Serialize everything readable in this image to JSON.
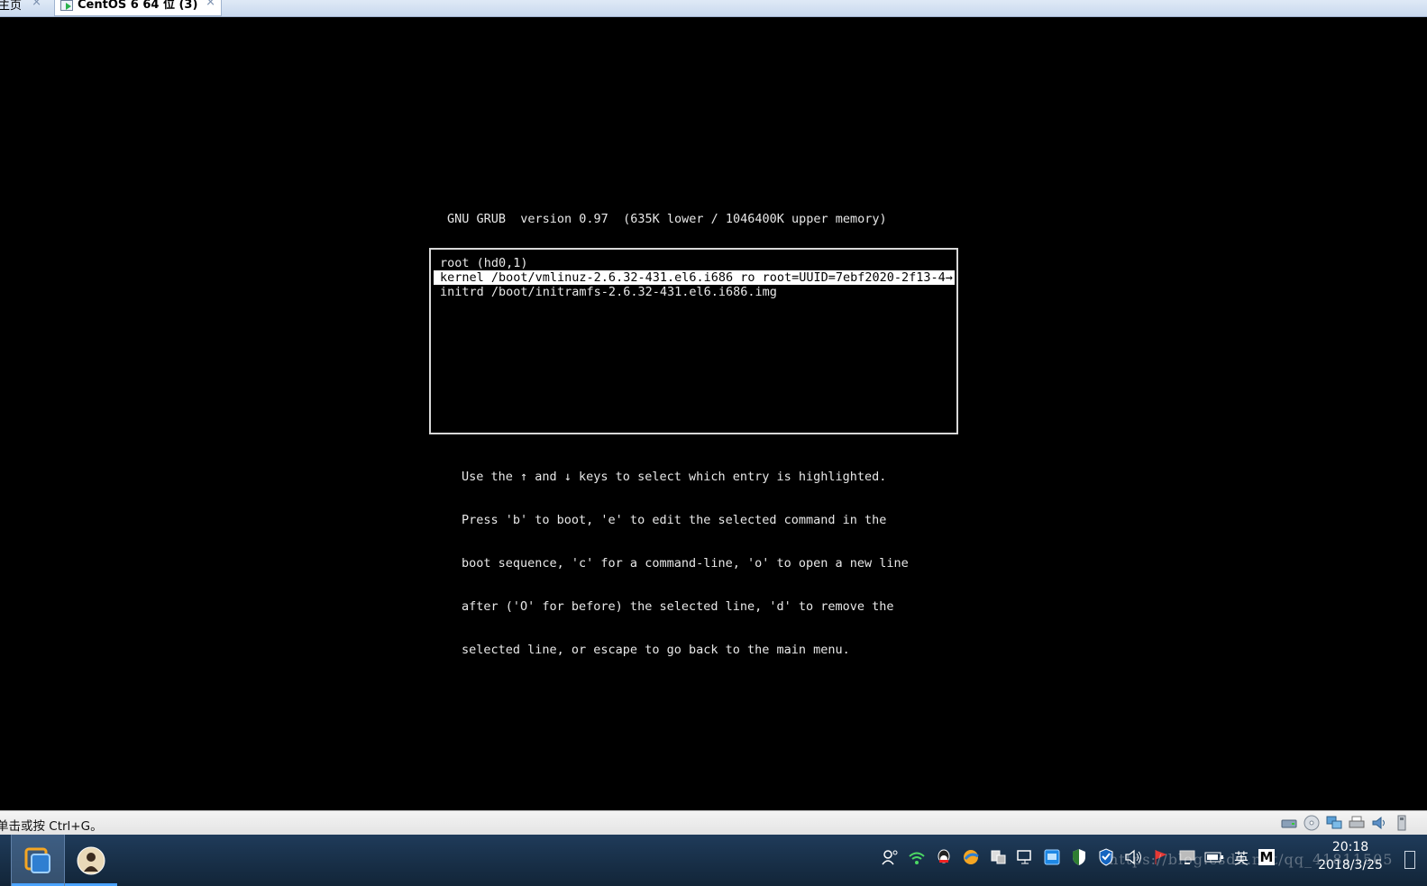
{
  "tabs": [
    {
      "label": "主页",
      "active": false
    },
    {
      "label": "CentOS 6 64 位 (3)",
      "active": true
    }
  ],
  "tab_close_glyph": "×",
  "grub": {
    "header": "GNU GRUB  version 0.97  (635K lower / 1046400K upper memory)",
    "entries": [
      "root (hd0,1)",
      "kernel /boot/vmlinuz-2.6.32-431.el6.i686 ro root=UUID=7ebf2020-2f13-4→",
      "initrd /boot/initramfs-2.6.32-431.el6.i686.img"
    ],
    "selected_index": 1,
    "help": [
      "Use the ↑ and ↓ keys to select which entry is highlighted.",
      "Press 'b' to boot, 'e' to edit the selected command in the",
      "boot sequence, 'c' for a command-line, 'o' to open a new line",
      "after ('O' for before) the selected line, 'd' to remove the",
      "selected line, or escape to go back to the main menu."
    ]
  },
  "status": {
    "hint": "单击或按 Ctrl+G。",
    "devices": [
      "hard-disk-icon",
      "cd-drive-icon",
      "network-adapter-icon",
      "printer-icon",
      "sound-card-icon",
      "usb-icon"
    ]
  },
  "taskbar": {
    "tray": {
      "ime_label": "英",
      "m_label": "M"
    },
    "clock": {
      "time": "20:18",
      "date": "2018/3/25"
    },
    "watermark": "https://blog.csdn.net/qq_41811505"
  },
  "colors": {
    "console_bg": "#000000",
    "console_fg": "#e8e8e8",
    "highlight_bg": "#ffffff",
    "taskbar_bg": "#1a3350",
    "tabbar_bg": "#d6e3f3"
  }
}
